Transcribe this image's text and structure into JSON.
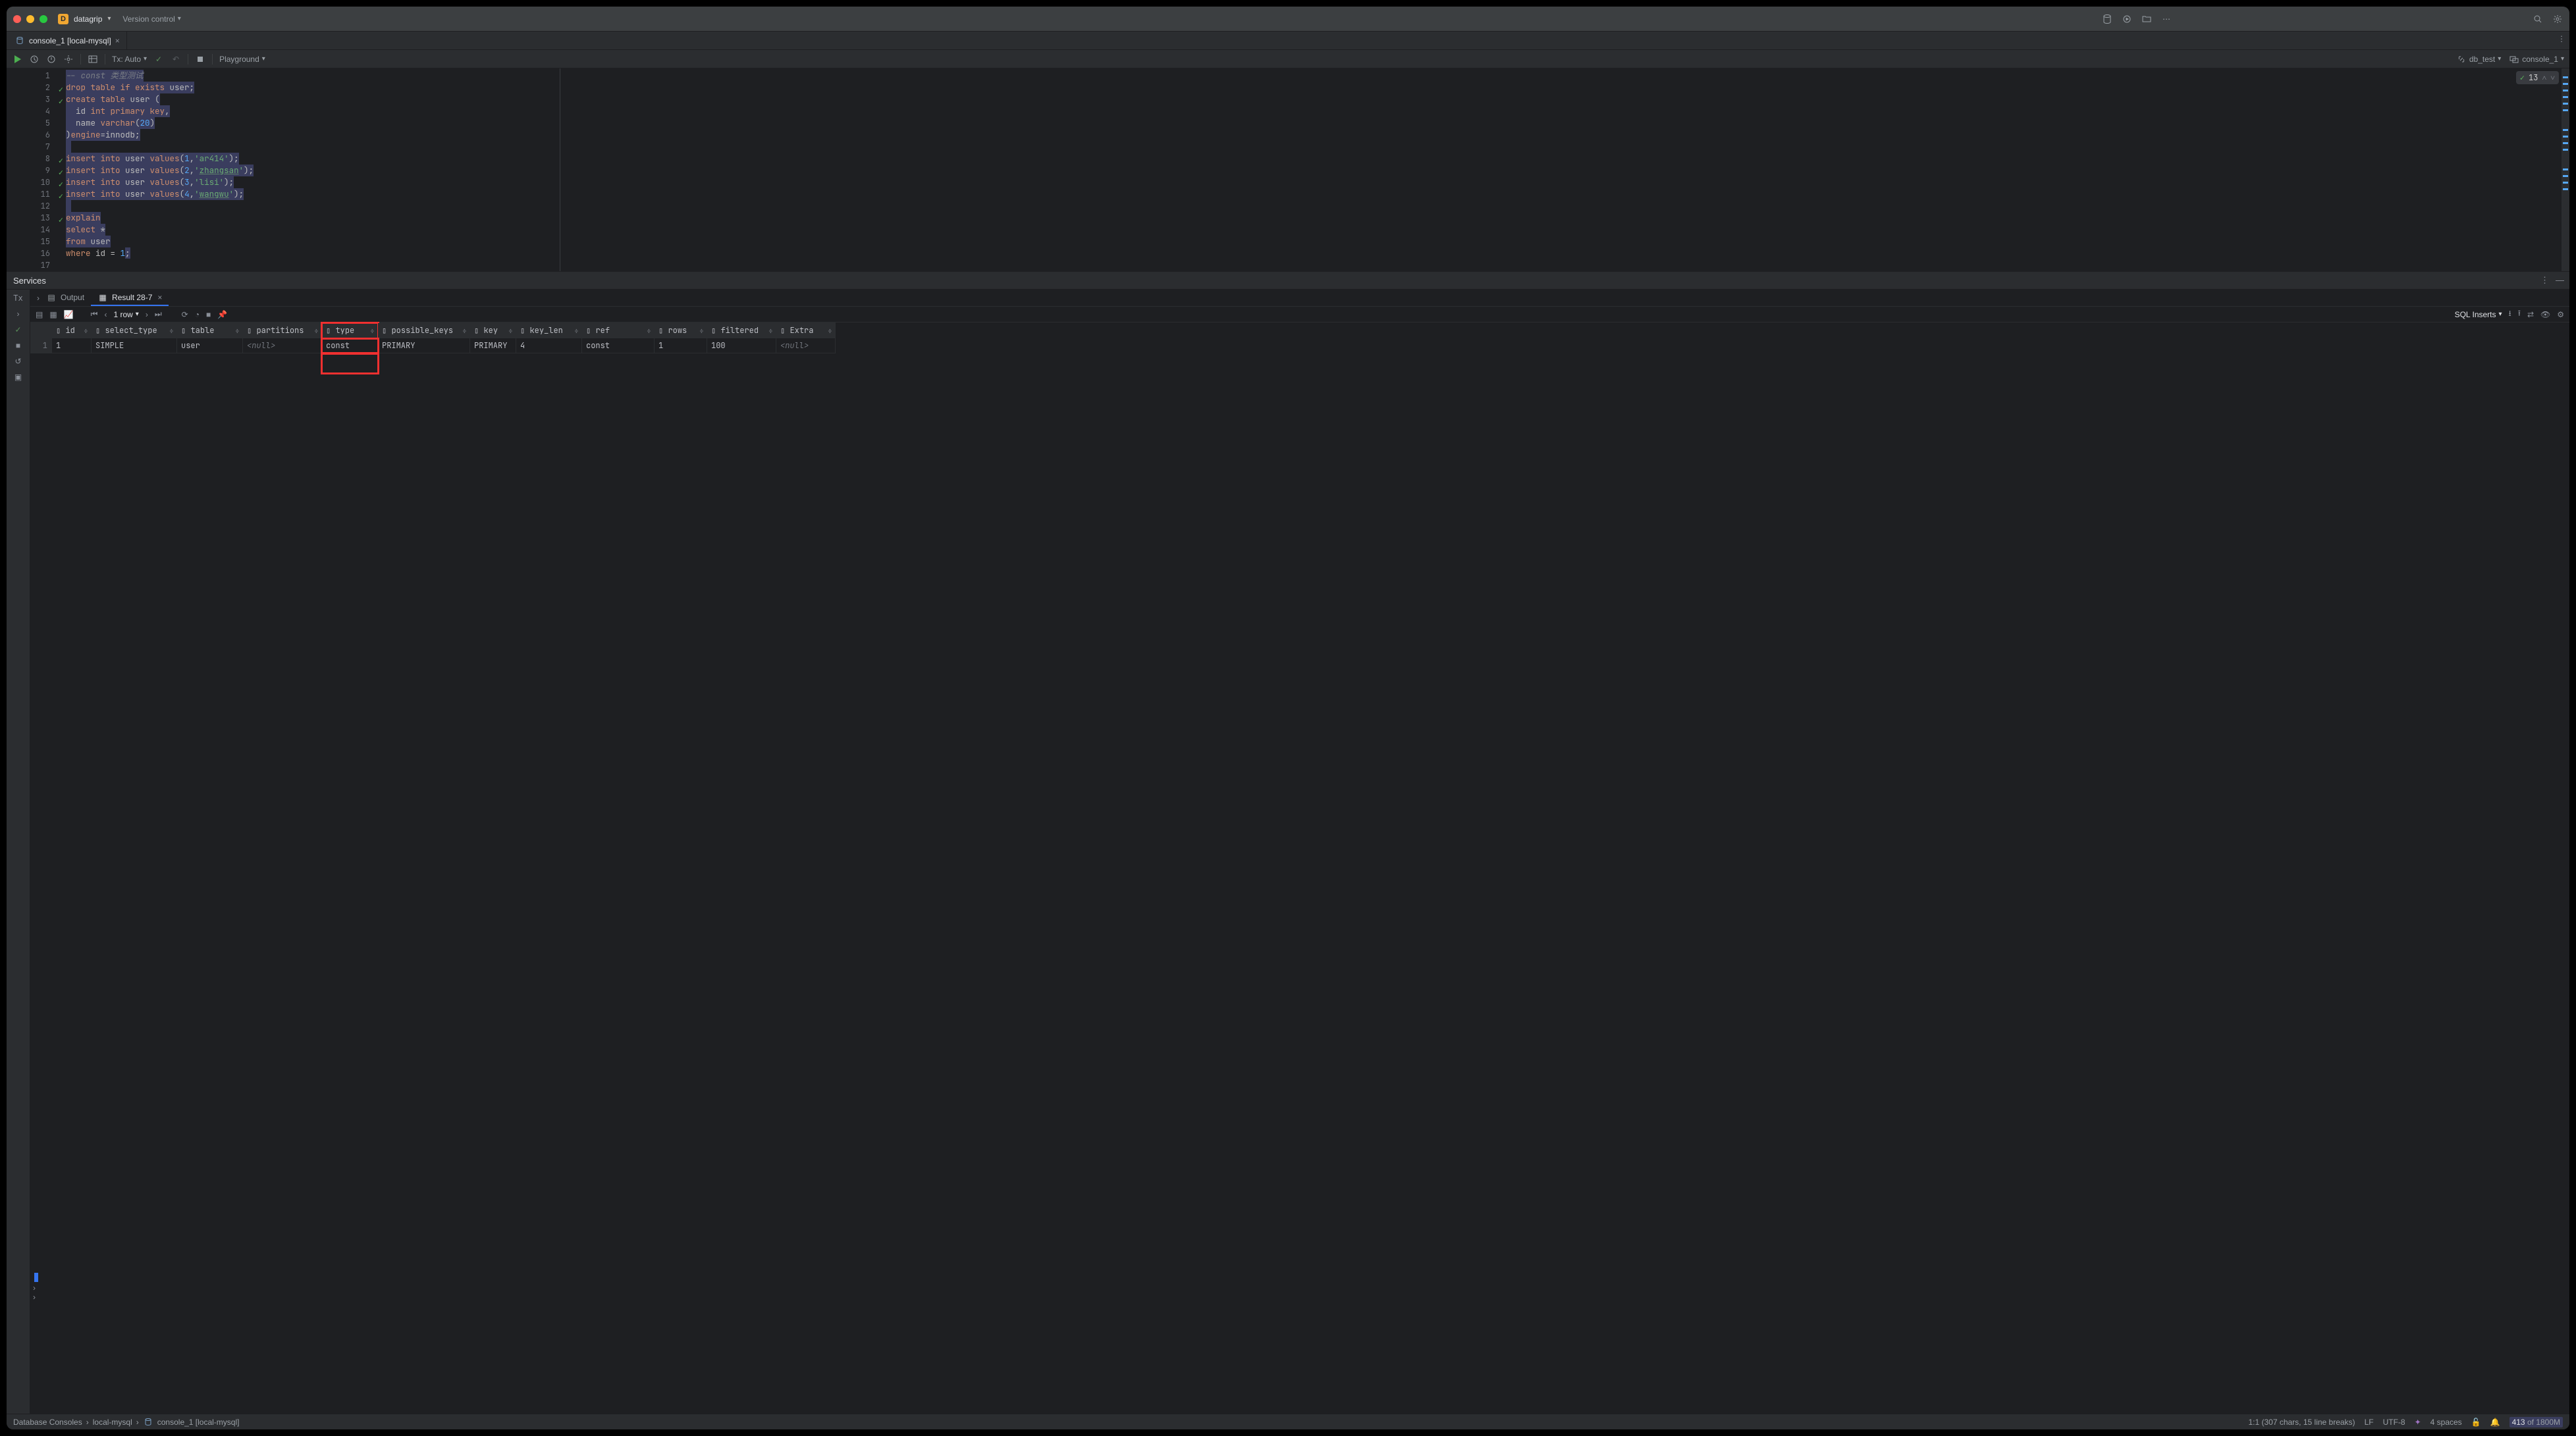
{
  "titlebar": {
    "project_badge": "D",
    "project_name": "datagrip",
    "vc_label": "Version control"
  },
  "tabs": [
    {
      "icon": "db-console",
      "label": "console_1 [local-mysql]"
    }
  ],
  "toolbar": {
    "tx_label": "Tx: Auto",
    "playground_label": "Playground",
    "db_label": "db_test",
    "console_label": "console_1"
  },
  "inspection": {
    "count": "13"
  },
  "editor": {
    "lines": [
      {
        "n": 1,
        "ok": false
      },
      {
        "n": 2,
        "ok": true
      },
      {
        "n": 3,
        "ok": true
      },
      {
        "n": 4,
        "ok": false
      },
      {
        "n": 5,
        "ok": false
      },
      {
        "n": 6,
        "ok": false
      },
      {
        "n": 7,
        "ok": false
      },
      {
        "n": 8,
        "ok": true
      },
      {
        "n": 9,
        "ok": true
      },
      {
        "n": 10,
        "ok": true
      },
      {
        "n": 11,
        "ok": true
      },
      {
        "n": 12,
        "ok": false
      },
      {
        "n": 13,
        "ok": true
      },
      {
        "n": 14,
        "ok": false
      },
      {
        "n": 15,
        "ok": false
      },
      {
        "n": 16,
        "ok": false
      },
      {
        "n": 17,
        "ok": false
      }
    ],
    "code_tokens": {
      "l1_cmt": "-- const 类型测试",
      "l2_a": "drop table if exists",
      "l2_b": " user;",
      "l3_a": "create table",
      "l3_b": " user (",
      "l4_a": "  id ",
      "l4_b": "int primary key",
      "l4_c": ",",
      "l5_a": "  name ",
      "l5_b": "varchar",
      "l5_c": "(",
      "l5_d": "20",
      "l5_e": ")",
      "l6_a": ")",
      "l6_b": "engine",
      "l6_c": "=innodb;",
      "l8_a": "insert into",
      "l8_b": " user ",
      "l8_c": "values",
      "l8_d": "(",
      "l8_e": "1",
      "l8_f": ",",
      "l8_g": "'ar414'",
      "l8_h": ");",
      "l9_a": "insert into",
      "l9_b": " user ",
      "l9_c": "values",
      "l9_d": "(",
      "l9_e": "2",
      "l9_f": ",",
      "l9_g": "'",
      "l9_h": "zhangsan",
      "l9_i": "'",
      ");": ");",
      "l9_j": ");",
      "l10_a": "insert into",
      "l10_b": " user ",
      "l10_c": "values",
      "l10_d": "(",
      "l10_e": "3",
      "l10_f": ",",
      "l10_g": "'lisi'",
      "l10_h": ");",
      "l11_a": "insert into",
      "l11_b": " user ",
      "l11_c": "values",
      "l11_d": "(",
      "l11_e": "4",
      "l11_f": ",",
      "l11_g": "'",
      "l11_h": "wangwu",
      "l11_i": "'",
      "l11_j": ");",
      "l13": "explain",
      "l14_a": "select",
      "l14_b": " *",
      "l15_a": "from",
      "l15_b": " user",
      "l16_a": "where",
      "l16_b": " id = ",
      "l16_c": "1",
      "l16_d": ";"
    }
  },
  "services": {
    "title": "Services",
    "tabs": {
      "output": "Output",
      "result": "Result 28-7"
    },
    "rows_label": "1 row",
    "sql_inserts": "SQL Inserts"
  },
  "grid": {
    "columns": [
      "id",
      "select_type",
      "table",
      "partitions",
      "type",
      "possible_keys",
      "key",
      "key_len",
      "ref",
      "rows",
      "filtered",
      "Extra"
    ],
    "rows": [
      {
        "rownum": "1",
        "id": "1",
        "select_type": "SIMPLE",
        "table": "user",
        "partitions": "<null>",
        "type": "const",
        "possible_keys": "PRIMARY",
        "key": "PRIMARY",
        "key_len": "4",
        "ref": "const",
        "rows": "1",
        "filtered": "100",
        "Extra": "<null>"
      }
    ]
  },
  "breadcrumb": [
    "Database Consoles",
    "local-mysql",
    "console_1 [local-mysql]"
  ],
  "statusbar": {
    "pos": "1:1 (307 chars, 15 line breaks)",
    "lf": "LF",
    "enc": "UTF-8",
    "indent": "4 spaces",
    "mem_used": "413",
    "mem_of": "of 1800M"
  }
}
